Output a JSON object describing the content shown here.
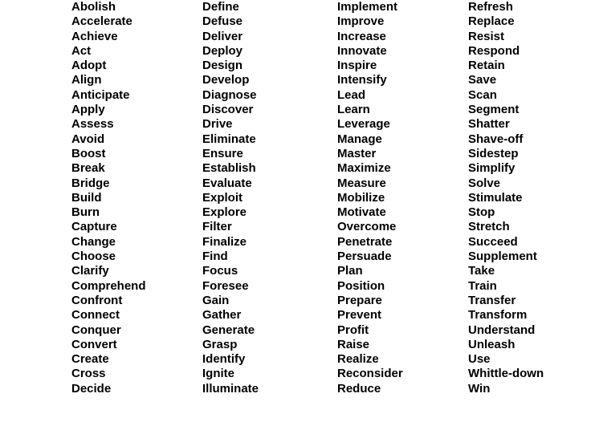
{
  "page": {
    "kind": "verb-list-sheet",
    "background_color": "#ffffff",
    "text_color": "#000000",
    "column_count": 4,
    "rows_per_column": 27
  },
  "columns": [
    {
      "name": "column-1",
      "items": [
        "Abolish",
        "Accelerate",
        "Achieve",
        "Act",
        "Adopt",
        "Align",
        "Anticipate",
        "Apply",
        "Assess",
        "Avoid",
        "Boost",
        "Break",
        "Bridge",
        "Build",
        "Burn",
        "Capture",
        "Change",
        "Choose",
        "Clarify",
        "Comprehend",
        "Confront",
        "Connect",
        "Conquer",
        "Convert",
        "Create",
        "Cross",
        "Decide"
      ]
    },
    {
      "name": "column-2",
      "items": [
        "Define",
        "Defuse",
        "Deliver",
        "Deploy",
        "Design",
        "Develop",
        "Diagnose",
        "Discover",
        "Drive",
        "Eliminate",
        "Ensure",
        "Establish",
        "Evaluate",
        "Exploit",
        "Explore",
        "Filter",
        "Finalize",
        "Find",
        "Focus",
        "Foresee",
        "Gain",
        "Gather",
        "Generate",
        "Grasp",
        "Identify",
        "Ignite",
        "Illuminate"
      ]
    },
    {
      "name": "column-3",
      "items": [
        "Implement",
        "Improve",
        "Increase",
        "Innovate",
        "Inspire",
        "Intensify",
        "Lead",
        "Learn",
        "Leverage",
        "Manage",
        "Master",
        "Maximize",
        "Measure",
        "Mobilize",
        "Motivate",
        "Overcome",
        "Penetrate",
        "Persuade",
        "Plan",
        "Position",
        "Prepare",
        "Prevent",
        "Profit",
        "Raise",
        "Realize",
        "Reconsider",
        "Reduce"
      ]
    },
    {
      "name": "column-4",
      "items": [
        "Refresh",
        "Replace",
        "Resist",
        "Respond",
        "Retain",
        "Save",
        "Scan",
        "Segment",
        "Shatter",
        "Shave-off",
        "Sidestep",
        "Simplify",
        "Solve",
        "Stimulate",
        "Stop",
        "Stretch",
        "Succeed",
        "Supplement",
        "Take",
        "Train",
        "Transfer",
        "Transform",
        "Understand",
        "Unleash",
        "Use",
        "Whittle-down",
        "Win"
      ]
    }
  ]
}
